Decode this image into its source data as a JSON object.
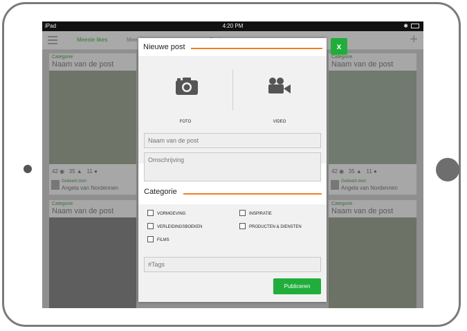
{
  "statusbar": {
    "carrier": "iPad",
    "wifi": "wifi-icon",
    "time": "4:20 PM",
    "bluetooth": "bluetooth-icon",
    "battery": "battery-icon"
  },
  "topnav": {
    "tabs": [
      {
        "label": "Meeste likes",
        "active": true
      },
      {
        "label": "Mee...",
        "active": false
      },
      {
        "label": "Zoeken ...",
        "active": false
      }
    ],
    "menu_icon": "hamburger-icon",
    "add_icon": "plus-icon"
  },
  "background_cards": [
    {
      "category": "Categorie",
      "title": "Naam van de post",
      "likes": "42",
      "thumbs": "35",
      "comments": "11",
      "shared_by": "Gedeeld door",
      "author": "Angela van Nordennen"
    },
    {
      "category": "Categorie",
      "title": "Naam van de post",
      "likes": "42",
      "thumbs": "35",
      "comments": "11",
      "shared_by": "Gedeeld door",
      "author": "Angela van Nordennen"
    },
    {
      "category": "Categorie",
      "title": "Naam van de post"
    },
    {
      "category": "Categorie",
      "title": "Naam van de post"
    }
  ],
  "modal": {
    "title": "Nieuwe post",
    "close_label": "x",
    "media": [
      {
        "label": "FOTO",
        "icon": "camera-icon"
      },
      {
        "label": "VIDEO",
        "icon": "video-camera-icon"
      }
    ],
    "name_placeholder": "Naam van de post",
    "description_placeholder": "Omschrijving",
    "category_heading": "Categorie",
    "categories": [
      {
        "label": "VORMGEVING",
        "checked": false
      },
      {
        "label": "INSPIRATIE",
        "checked": false
      },
      {
        "label": "VERLEIDINGSBOEKEN",
        "checked": false
      },
      {
        "label": "PRODUCTEN & DIENSTEN",
        "checked": false
      },
      {
        "label": "FILMS",
        "checked": false
      }
    ],
    "tags_placeholder": "#Tags",
    "publish_label": "Publiceren"
  },
  "colors": {
    "accent_green": "#1fae3a",
    "accent_orange": "#f07f1f",
    "overlay_gray": "#8f8f8f"
  }
}
